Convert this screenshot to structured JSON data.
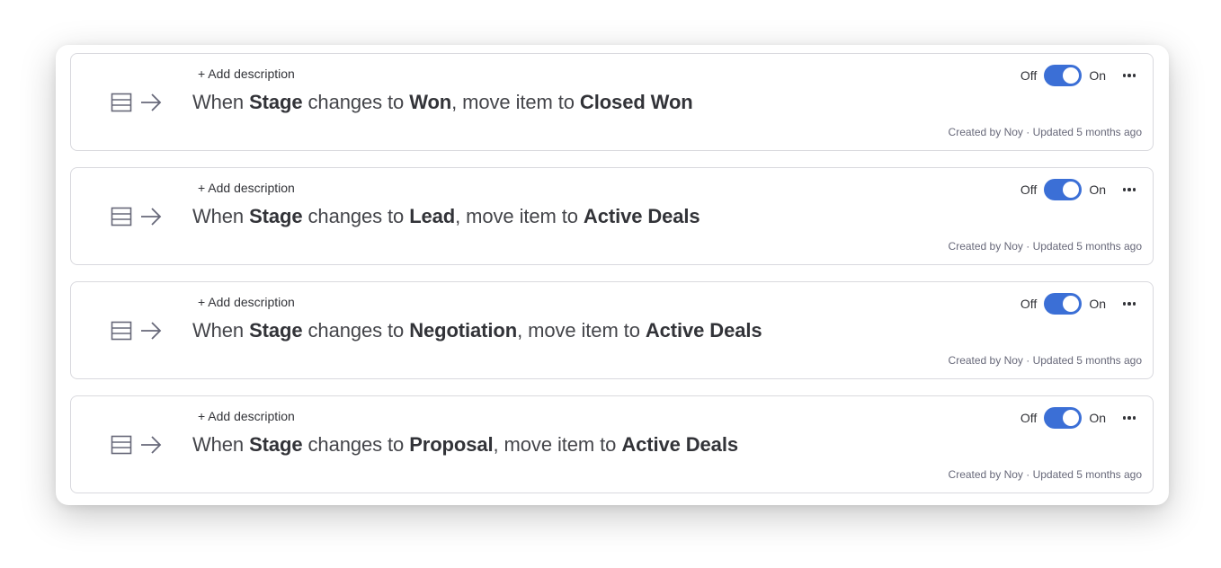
{
  "automations": [
    {
      "add_description": "+ Add description",
      "when": "When",
      "column": "Stage",
      "changes_to": "changes to",
      "status": "Won",
      "move_text": ", move item to",
      "target_group": "Closed Won",
      "toggle_off_label": "Off",
      "toggle_on_label": "On",
      "toggle_state": "on",
      "meta": "Created by Noy · Updated 5 months ago"
    },
    {
      "add_description": "+ Add description",
      "when": "When",
      "column": "Stage",
      "changes_to": "changes to",
      "status": "Lead",
      "move_text": ", move item to",
      "target_group": "Active Deals",
      "toggle_off_label": "Off",
      "toggle_on_label": "On",
      "toggle_state": "on",
      "meta": "Created by Noy · Updated 5 months ago"
    },
    {
      "add_description": "+ Add description",
      "when": "When",
      "column": "Stage",
      "changes_to": "changes to",
      "status": "Negotiation",
      "move_text": ", move item to",
      "target_group": "Active Deals",
      "toggle_off_label": "Off",
      "toggle_on_label": "On",
      "toggle_state": "on",
      "meta": "Created by Noy · Updated 5 months ago"
    },
    {
      "add_description": "+ Add description",
      "when": "When",
      "column": "Stage",
      "changes_to": "changes to",
      "status": "Proposal",
      "move_text": ", move item to",
      "target_group": "Active Deals",
      "toggle_off_label": "Off",
      "toggle_on_label": "On",
      "toggle_state": "on",
      "meta": "Created by Noy · Updated 5 months ago"
    }
  ],
  "icons": {
    "trigger": "board-list-icon",
    "action": "arrow-right-icon",
    "menu": "more-options-icon"
  },
  "colors": {
    "toggle_on": "#3b6fd6",
    "text": "#323338",
    "meta": "#676879"
  }
}
